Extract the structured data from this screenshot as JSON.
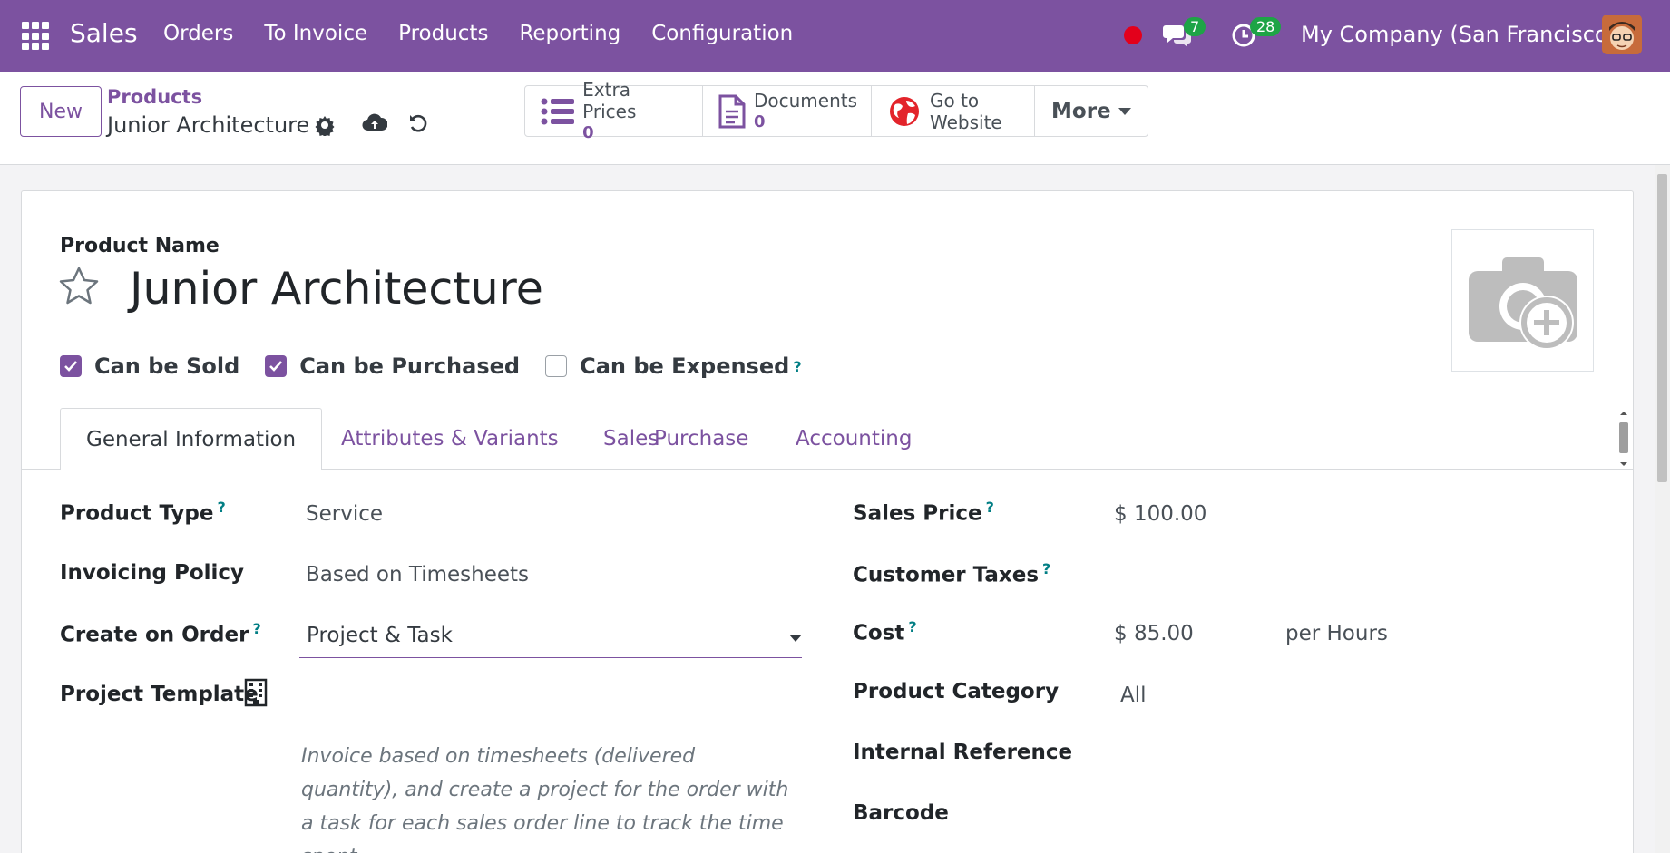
{
  "navbar": {
    "app_name": "Sales",
    "menu": [
      "Orders",
      "To Invoice",
      "Products",
      "Reporting",
      "Configuration"
    ],
    "chat_count": "7",
    "activity_count": "28",
    "company": "My Company (San Francisco)"
  },
  "control": {
    "new_label": "New",
    "breadcrumb": "Products",
    "record_title": "Junior Architecture",
    "smart_buttons": [
      {
        "label": "Extra Prices",
        "count": "0",
        "icon": "list-icon"
      },
      {
        "label": "Documents",
        "count": "0",
        "icon": "document-icon"
      },
      {
        "label": "Go to",
        "label2": "Website",
        "icon": "globe-icon"
      }
    ],
    "more_label": "More"
  },
  "form": {
    "name_label": "Product Name",
    "product_name": "Junior Architecture",
    "checkboxes": [
      {
        "label": "Can be Sold",
        "checked": true
      },
      {
        "label": "Can be Purchased",
        "checked": true
      },
      {
        "label": "Can be Expensed",
        "checked": false,
        "help": "?"
      }
    ],
    "tabs": [
      "General Information",
      "Attributes & Variants",
      "Sales",
      "Purchase",
      "Accounting"
    ],
    "left_fields": {
      "product_type_label": "Product Type",
      "product_type_value": "Service",
      "invoicing_policy_label": "Invoicing Policy",
      "invoicing_policy_value": "Based on Timesheets",
      "create_on_order_label": "Create on Order",
      "create_on_order_value": "Project & Task",
      "project_template_label": "Project Template",
      "help_text": "Invoice based on timesheets (delivered quantity), and create a project for the order with a task for each sales order line to track the time spent."
    },
    "right_fields": {
      "sales_price_label": "Sales Price",
      "sales_price_value": "$ 100.00",
      "customer_taxes_label": "Customer Taxes",
      "cost_label": "Cost",
      "cost_value": "$ 85.00",
      "cost_unit": "per Hours",
      "category_label": "Product Category",
      "category_value": "All",
      "internal_ref_label": "Internal Reference",
      "barcode_label": "Barcode"
    },
    "help_mark": "?"
  },
  "colors": {
    "brand": "#7c52a0",
    "badge": "#1ea446",
    "help": "#017e84"
  }
}
